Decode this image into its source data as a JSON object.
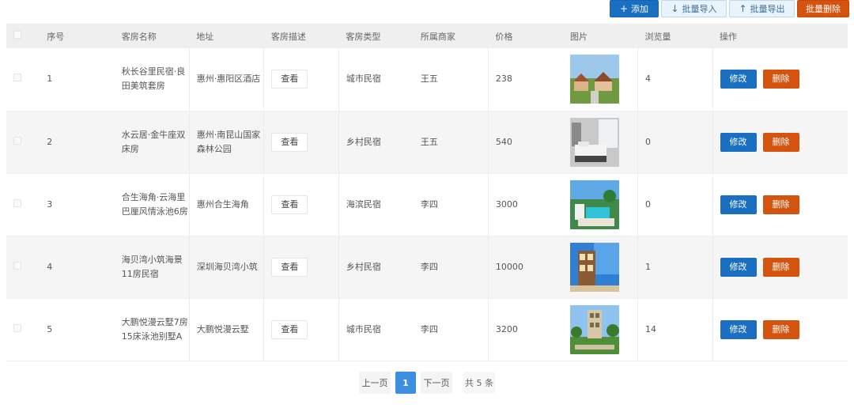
{
  "toolbar": {
    "add": "添加",
    "import": "批量导入",
    "export": "批量导出",
    "batch_delete": "批量删除"
  },
  "table": {
    "headers": {
      "index": "序号",
      "name": "客房名称",
      "address": "地址",
      "desc": "客房描述",
      "type": "客房类型",
      "merchant": "所属商家",
      "price": "价格",
      "image": "图片",
      "views": "浏览量",
      "ops": "操作"
    },
    "view_label": "查看",
    "edit_label": "修改",
    "delete_label": "删除",
    "rows": [
      {
        "index": "1",
        "name": "秋长谷里民宿·良田美筑套房",
        "address": "惠州·惠阳区酒店",
        "type": "城市民宿",
        "merchant": "王五",
        "price": "238",
        "views": "4"
      },
      {
        "index": "2",
        "name": "水云居·金牛座双床房",
        "address": "惠州·南昆山国家森林公园",
        "type": "乡村民宿",
        "merchant": "王五",
        "price": "540",
        "views": "0"
      },
      {
        "index": "3",
        "name": "合生海角·云海里巴厘风情泳池6房",
        "address": "惠州合生海角",
        "type": "海滨民宿",
        "merchant": "李四",
        "price": "3000",
        "views": "0"
      },
      {
        "index": "4",
        "name": "海贝湾小筑海景11房民宿",
        "address": "深圳海贝湾小筑",
        "type": "乡村民宿",
        "merchant": "李四",
        "price": "10000",
        "views": "1"
      },
      {
        "index": "5",
        "name": "大鹏悦漫云墅7房15床泳池别墅A",
        "address": "大鹏悦漫云墅",
        "type": "城市民宿",
        "merchant": "李四",
        "price": "3200",
        "views": "14"
      }
    ]
  },
  "pagination": {
    "prev": "上一页",
    "current": "1",
    "next": "下一页",
    "total": "共 5 条"
  }
}
